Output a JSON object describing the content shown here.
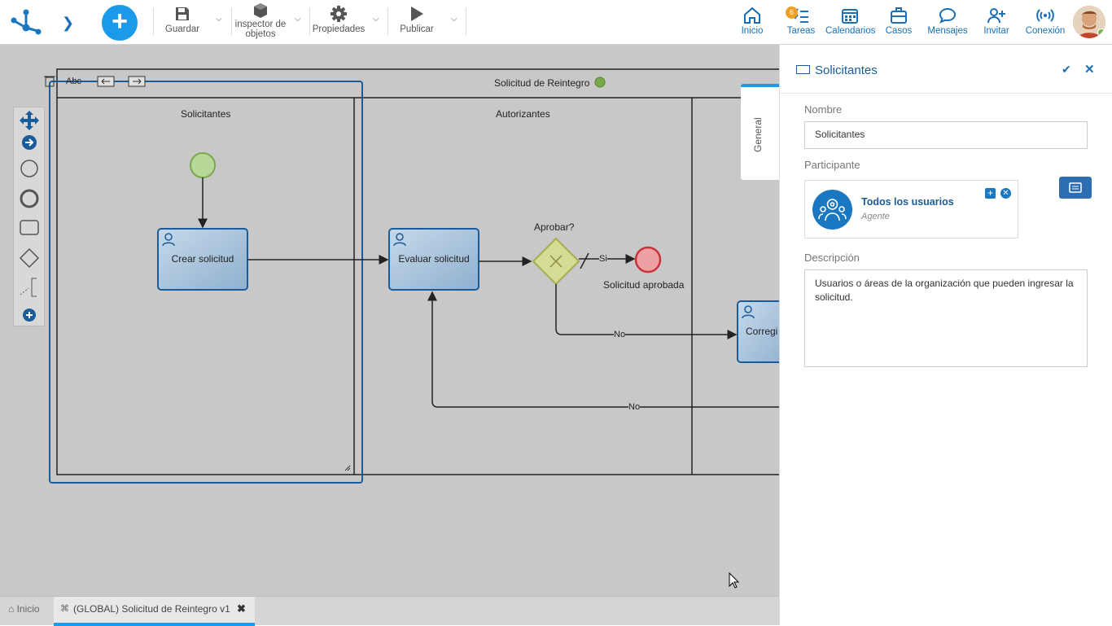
{
  "topbar": {
    "save_label": "Guardar",
    "inspector_label_1": "inspector de",
    "inspector_label_2": "objetos",
    "properties_label": "Propiedades",
    "publish_label": "Publicar",
    "nav": {
      "home": "Inicio",
      "tasks": "Tareas",
      "tasks_badge": "6",
      "calendars": "Calendarios",
      "cases": "Casos",
      "messages": "Mensajes",
      "invite": "Invitar",
      "connection": "Conexión"
    }
  },
  "diagram": {
    "pool_title": "Solicitud de Reintegro",
    "lanes": [
      "Solicitantes",
      "Autorizantes"
    ],
    "lane_tools_label": "Abc",
    "tasks": {
      "create": "Crear solicitud",
      "evaluate": "Evaluar solicitud",
      "correct": "Corregi"
    },
    "gateway_label": "Aprobar?",
    "end_label": "Solicitud aprobada",
    "flow_yes": "Si",
    "flow_no_1": "No",
    "flow_no_2": "No"
  },
  "panel": {
    "title": "Solicitantes",
    "tab_general": "General",
    "name_label": "Nombre",
    "name_value": "Solicitantes",
    "participant_label": "Participante",
    "participant_name": "Todos los usuarios",
    "participant_role": "Agente",
    "description_label": "Descripción",
    "description_value": "Usuarios o áreas de la organización que pueden ingresar la solicitud."
  },
  "bottom": {
    "home_tab": "Inicio",
    "process_tab": "(GLOBAL) Solicitud de Reintegro v1"
  },
  "colors": {
    "accent": "#1a9ae8",
    "brand_blue": "#1a6fb5",
    "task_fill": "#a9c4dc",
    "gateway_fill": "#d6dc96",
    "start_fill": "#b8d89a",
    "end_stroke": "#c8323a"
  }
}
